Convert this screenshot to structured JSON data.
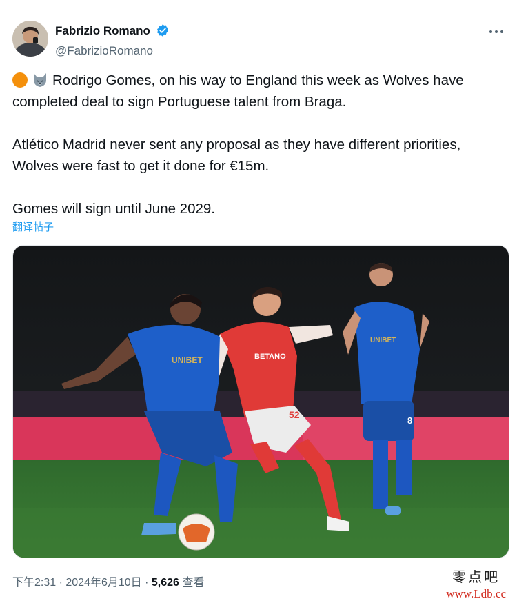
{
  "author": {
    "display_name": "Fabrizio Romano",
    "handle": "@FabrizioRomano",
    "verified": true,
    "avatar_icon": "avatar-photo"
  },
  "menu": {
    "icon": "more-icon"
  },
  "tweet": {
    "line1_emojis": [
      "orange-circle-icon",
      "wolf-icon"
    ],
    "paragraph1": "Rodrigo Gomes, on his way to England this week as Wolves have completed deal to sign Portuguese talent from Braga.",
    "paragraph2": "Atlético Madrid never sent any proposal as they have different priorities, Wolves were fast to get it done for €15m.",
    "paragraph3": "Gomes will sign until June 2029.",
    "translate_label": "翻译帖子"
  },
  "media": {
    "alt_icon": "football-match-photo",
    "players": [
      {
        "kit": "blue",
        "sponsor": "UNIBET"
      },
      {
        "kit": "red",
        "sponsor": "BETANO",
        "number": "52"
      },
      {
        "kit": "blue",
        "sponsor": "UNIBET",
        "number": "8"
      }
    ]
  },
  "meta": {
    "time": "下午2:31",
    "sep1": " · ",
    "date": "2024年6月10日",
    "sep2": " · ",
    "views": "5,626",
    "views_label": " 查看"
  },
  "watermark": {
    "text": "零点吧",
    "url": "www.Ldb.cc"
  },
  "colors": {
    "link": "#1d9bf0",
    "verified": "#1d9bf0",
    "secondary": "#536471",
    "wolves_orange": "#f4900c"
  }
}
